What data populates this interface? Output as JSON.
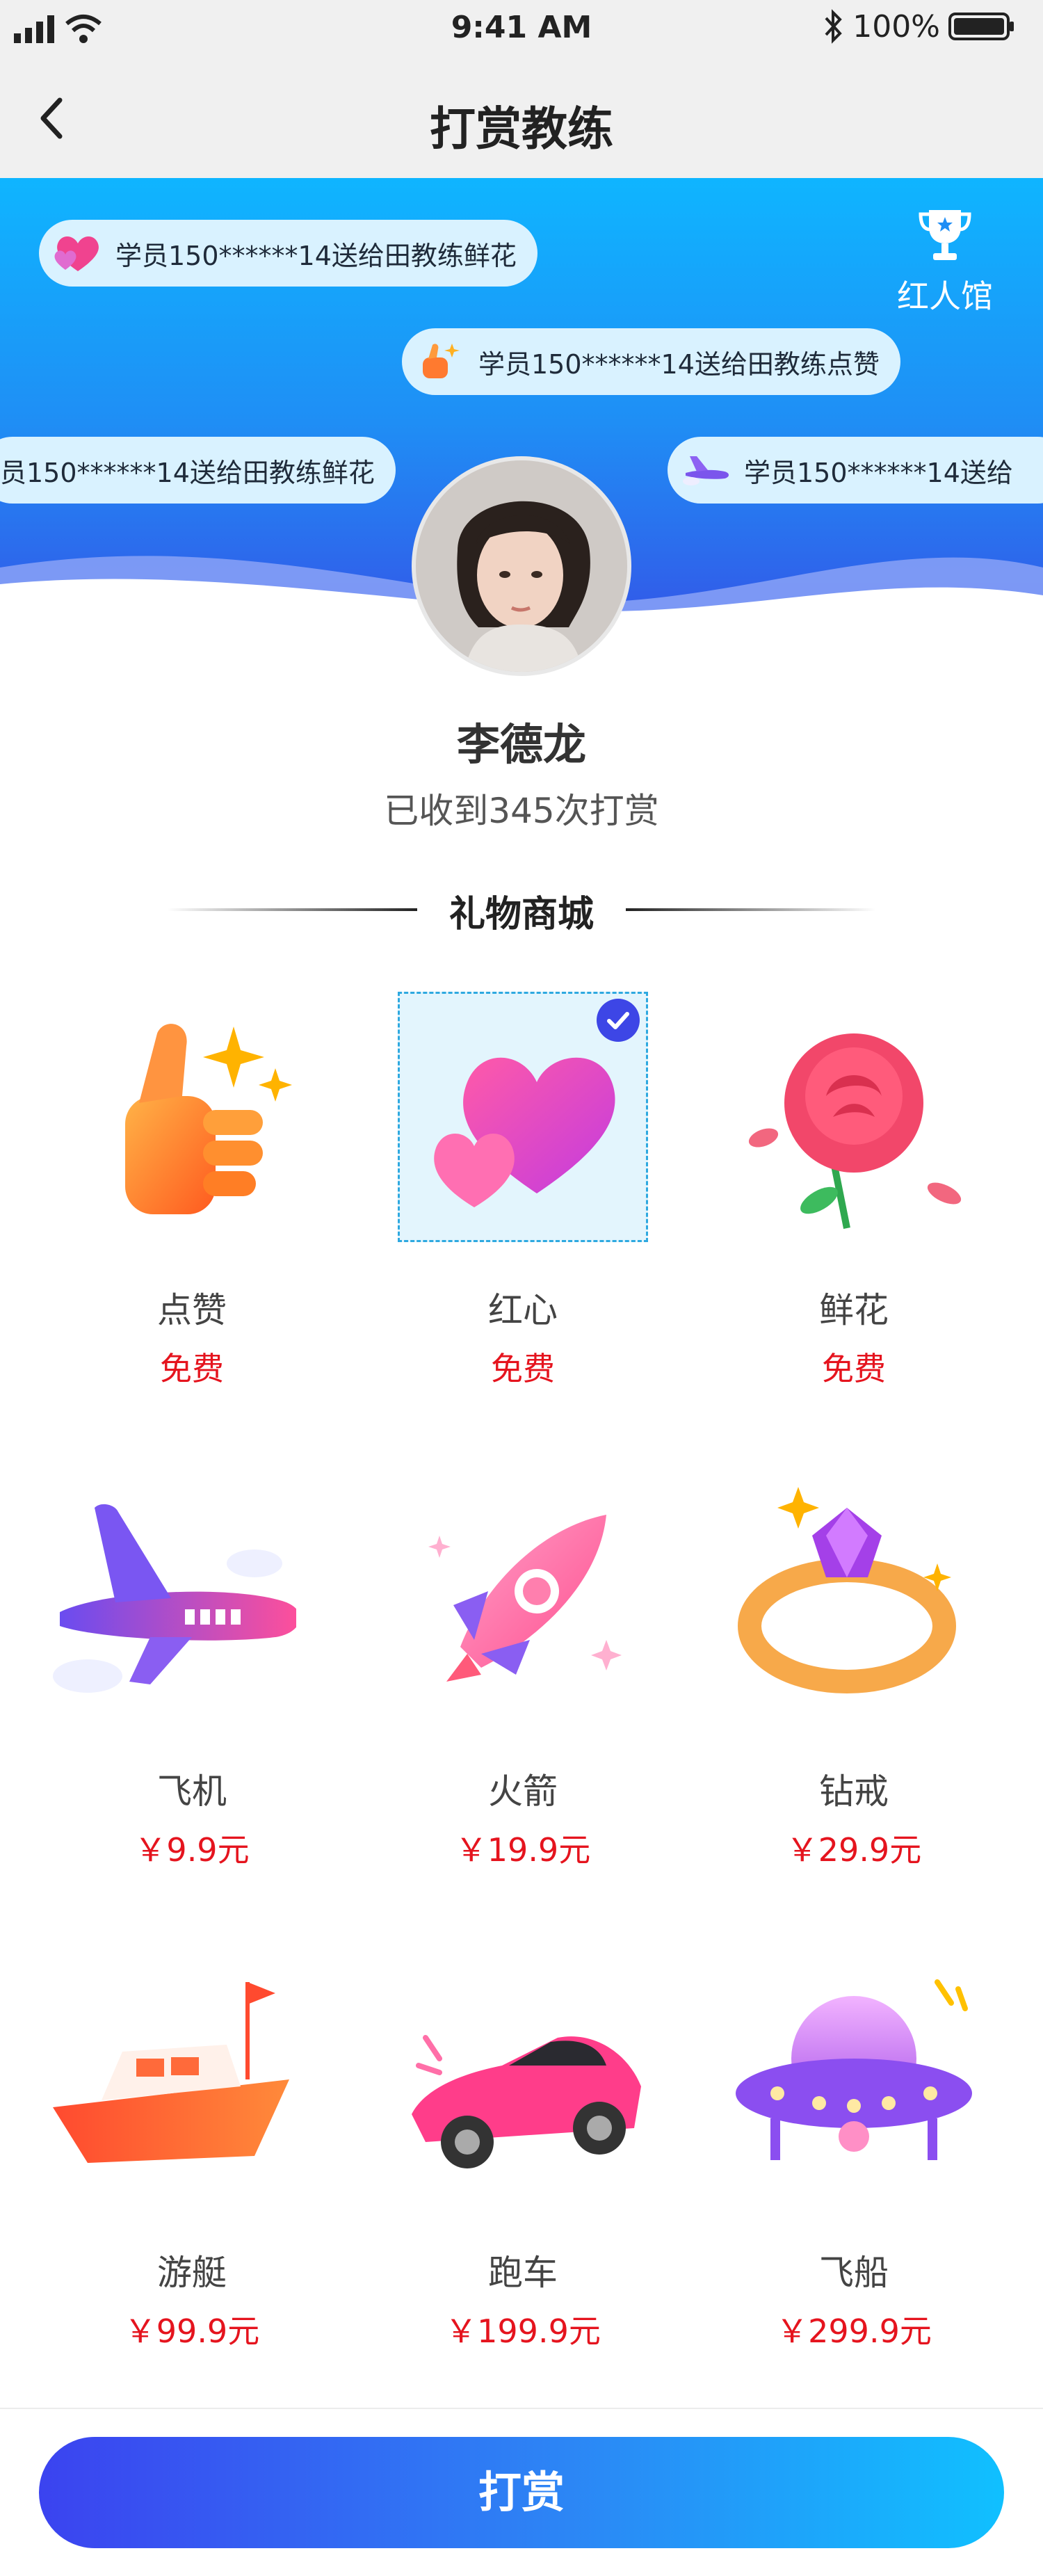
{
  "status_bar": {
    "time": "9:41 AM",
    "battery": "100%"
  },
  "nav": {
    "title": "打赏教练"
  },
  "famous_hall": {
    "label": "红人馆"
  },
  "ticker": [
    {
      "text": "学员150******14送给田教练鲜花",
      "icon": "heart-icon"
    },
    {
      "text": "学员150******14送给田教练点赞",
      "icon": "thumbs-up-icon"
    },
    {
      "text": "员150******14送给田教练鲜花",
      "icon": "heart-icon"
    },
    {
      "text": "学员150******14送给",
      "icon": "airplane-icon"
    }
  ],
  "coach": {
    "name": "李德龙",
    "reward_count_text": "已收到345次打赏"
  },
  "shop": {
    "title": "礼物商城"
  },
  "gifts": [
    {
      "name": "点赞",
      "price": "免费",
      "icon": "thumbs-up-icon"
    },
    {
      "name": "红心",
      "price": "免费",
      "icon": "heart-icon",
      "selected": true
    },
    {
      "name": "鲜花",
      "price": "免费",
      "icon": "rose-icon"
    },
    {
      "name": "飞机",
      "price": "￥9.9元",
      "icon": "airplane-icon"
    },
    {
      "name": "火箭",
      "price": "￥19.9元",
      "icon": "rocket-icon"
    },
    {
      "name": "钻戒",
      "price": "￥29.9元",
      "icon": "diamond-ring-icon"
    },
    {
      "name": "游艇",
      "price": "￥99.9元",
      "icon": "yacht-icon"
    },
    {
      "name": "跑车",
      "price": "￥199.9元",
      "icon": "sports-car-icon"
    },
    {
      "name": "飞船",
      "price": "￥299.9元",
      "icon": "ufo-icon"
    }
  ],
  "action": {
    "reward_button": "打赏"
  },
  "colors": {
    "accent": "#3d46e6",
    "price_red": "#e5141e",
    "hero_top": "#0fb5ff",
    "hero_bottom": "#3358e8"
  }
}
